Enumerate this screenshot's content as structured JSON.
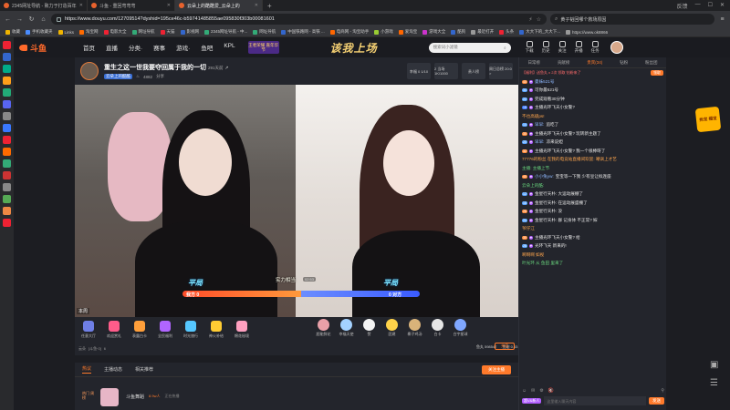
{
  "browser": {
    "tabs": [
      {
        "label": "2345网址导航 - 致力于打造百年",
        "active": false
      },
      {
        "label": "斗鱼 - 重回弯弯弯",
        "active": false
      },
      {
        "label": "云朵上的酷酷爱_云朵上的",
        "active": true
      }
    ],
    "url": "https://www.douyu.com/12709514?dyshid=195ce46c-b59741485855ae095830f303b00081601",
    "search_placeholder": "黄子韬回哪个救场原因",
    "window_label": "反馈",
    "bookmarks": [
      {
        "label": "收藏",
        "color": "#f0b400"
      },
      {
        "label": "手机收藏夹",
        "color": "#4a8cff"
      },
      {
        "label": "Links",
        "color": "#f0b400"
      },
      {
        "label": "淘宝网",
        "color": "#ff6a00"
      },
      {
        "label": "电影大全",
        "color": "#e23"
      },
      {
        "label": "网址导航",
        "color": "#3a7"
      },
      {
        "label": "天猫",
        "color": "#e23"
      },
      {
        "label": "影视网",
        "color": "#36c"
      },
      {
        "label": "2345网址导航 - 中...",
        "color": "#3a7"
      },
      {
        "label": "网址导航",
        "color": "#3a7"
      },
      {
        "label": "中国铁路网 - 高铁 ...",
        "color": "#36c"
      },
      {
        "label": "电商网 - 淘宝助手",
        "color": "#f60"
      },
      {
        "label": "小游戏",
        "color": "#9c3"
      },
      {
        "label": "爱淘宝",
        "color": "#f60"
      },
      {
        "label": "游戏大全",
        "color": "#c3c"
      },
      {
        "label": "酷狗",
        "color": "#36c"
      },
      {
        "label": "最近打开",
        "color": "#999"
      },
      {
        "label": "头条",
        "color": "#e23"
      },
      {
        "label": "大大下的_大大下...",
        "color": "#36c"
      },
      {
        "label": "https://www.ok8866",
        "color": "#999"
      }
    ]
  },
  "header": {
    "logo": "斗鱼",
    "nav": [
      "首页",
      "直播",
      "分类·",
      "赛事",
      "游戏·",
      "鱼吧",
      "KPL"
    ],
    "promo": "王者荣耀 嘉年华节",
    "banner": "该我上场",
    "search_placeholder": "搜索词小滤镜",
    "tools": [
      "下载",
      "历史",
      "关注",
      "开播",
      "任务"
    ]
  },
  "room": {
    "title": "重生之这一世我要夺回属于我的一切",
    "badge_text": "291天前",
    "subtitle_tag": "云朵上的酷酷",
    "heat": "4882",
    "share_label": "分享",
    "stats": [
      "幸福 0 1/10",
      "2 当场 1K/1000",
      "贵人榜",
      "周日总榜 20:0 >"
    ]
  },
  "video": {
    "left_label": "平局",
    "right_label": "平局",
    "left_score": "我方 0",
    "right_score": "0 对方",
    "mid_label": "实力相当",
    "mid_time": "02:53",
    "pk_ratio": 0.5,
    "tag": "本周"
  },
  "gift_icons": [
    {
      "label": "任意大厅",
      "color": "#6f7fe6"
    },
    {
      "label": "欢迎赏礼",
      "color": "#ff5c8a"
    },
    {
      "label": "表露白卡",
      "color": "#ff9f3a"
    },
    {
      "label": "全民福利",
      "color": "#b065ff"
    },
    {
      "label": "时光旅行",
      "color": "#56c8ff"
    },
    {
      "label": "神火补给",
      "color": "#ffcc33"
    },
    {
      "label": "棉花秘境",
      "color": "#ffa0c0"
    }
  ],
  "gifts": [
    {
      "label": "超能鲜花",
      "color": "#e8a0a8"
    },
    {
      "label": "幸福天使",
      "color": "#a4d2ff"
    },
    {
      "label": "赞",
      "color": "#f3f3f3"
    },
    {
      "label": "团建",
      "color": "#ffd34a"
    },
    {
      "label": "椰子鸡汤",
      "color": "#d9b37a"
    },
    {
      "label": "白卡",
      "color": "#e6e6e6"
    },
    {
      "label": "白宇星球",
      "color": "#7fa7ff"
    }
  ],
  "fish_info": [
    "云朵",
    "[斗鱼·0]",
    "6"
  ],
  "balance": [
    "鱼丸 598547",
    "鱼翅 0.53"
  ],
  "recharge": "充值",
  "bottom": {
    "tabs": [
      "热议",
      "主播动态",
      "相关推荐"
    ],
    "follow_button": "关注主播",
    "team_label": "热门 周榜",
    "row_title": "斗鱼舞蹈",
    "row_sub": "8.9w人",
    "row_meta": "正在热播"
  },
  "chat": {
    "tabs": [
      "日常榜",
      "贡献榜",
      "贵宾(34)",
      "钻粉",
      "粉丝团"
    ],
    "notice": "【福利】送鱼丸 x 2次 领取 钻粉来了",
    "notice_button": "领取",
    "messages": [
      {
        "lv": "40",
        "lvc": "#ff8a3a",
        "name": "曼妹521号",
        "text": "",
        "kind": "user"
      },
      {
        "lv": "34",
        "lvc": "#58a4ff",
        "name": "",
        "text": "可你最521号",
        "kind": "user"
      },
      {
        "lv": "22",
        "lvc": "#58a4ff",
        "name": "",
        "text": "完成观看30分钟",
        "kind": "user"
      },
      {
        "lv": "18",
        "lvc": "#3a78ff",
        "name": "",
        "text": "主播光环飞天小女警?",
        "kind": "user"
      },
      {
        "lv": "",
        "lvc": "",
        "name": "",
        "text": "不也高级ps!",
        "kind": "sys"
      },
      {
        "lv": "14",
        "lvc": "#58a4ff",
        "name": "早早:",
        "text": "追吃了",
        "kind": "user"
      },
      {
        "lv": "30",
        "lvc": "#ff8a3a",
        "name": "",
        "text": "主播光环飞天小女警? 玩转新主题了",
        "kind": "user"
      },
      {
        "lv": "20",
        "lvc": "#58a4ff",
        "name": "早早:",
        "text": "凉来说妲",
        "kind": "user"
      },
      {
        "lv": "32",
        "lvc": "#ff8a3a",
        "name": "",
        "text": "主播光环飞天小女警? 我一个很棒呀了",
        "kind": "user"
      },
      {
        "lv": "",
        "lvc": "",
        "name": "",
        "text": "77776的粉丝 在我的电竞站直播间欢迎: 嘲讽上才艺",
        "kind": "gold"
      },
      {
        "lv": "",
        "lvc": "",
        "name": "",
        "text": "主播: 主播上节",
        "kind": "sys2"
      },
      {
        "lv": "40",
        "lvc": "#ff8a3a",
        "name": "小小兔yw:",
        "text": "宝宝等一下我 少有豆让拟连座",
        "kind": "user"
      },
      {
        "lv": "",
        "lvc": "",
        "name": "",
        "text": "云朵上的酷:",
        "kind": "sys2"
      },
      {
        "lv": "12",
        "lvc": "#58a4ff",
        "name": "",
        "text": "金星行天朴: 大运动展棚了",
        "kind": "user"
      },
      {
        "lv": "16",
        "lvc": "#58a4ff",
        "name": "",
        "text": "金星行天朴: 在运动展盛棚了",
        "kind": "user"
      },
      {
        "lv": "26",
        "lvc": "#ff8a3a",
        "name": "",
        "text": "金星行天朴: 没",
        "kind": "user"
      },
      {
        "lv": "24",
        "lvc": "#58a4ff",
        "name": "",
        "text": "金星行天朴: 群 记身体 不正常? 嫁",
        "kind": "user"
      },
      {
        "lv": "",
        "lvc": "",
        "name": "",
        "text": "爷仔江",
        "kind": "sys"
      },
      {
        "lv": "30",
        "lvc": "#ff8a3a",
        "name": "",
        "text": "主播光环飞天小女警? 给",
        "kind": "user"
      },
      {
        "lv": "26",
        "lvc": "#58a4ff",
        "name": "",
        "text": "光环飞天 新来的!",
        "kind": "user"
      },
      {
        "lv": "",
        "lvc": "",
        "name": "",
        "text": "啊啊啊 如视",
        "kind": "sys"
      },
      {
        "lv": "",
        "lvc": "",
        "name": "",
        "text": "叶光环 从 鱼田 里来了",
        "kind": "sys2"
      }
    ],
    "input_level": "超V&新人",
    "input_placeholder": "这里输入聊天内容",
    "send_label": "发送"
  },
  "treasure_label": "抢宝 福宝",
  "colors": {
    "brand": "#ff7a2b",
    "chrome": "#35363a",
    "panel": "#23252c"
  }
}
